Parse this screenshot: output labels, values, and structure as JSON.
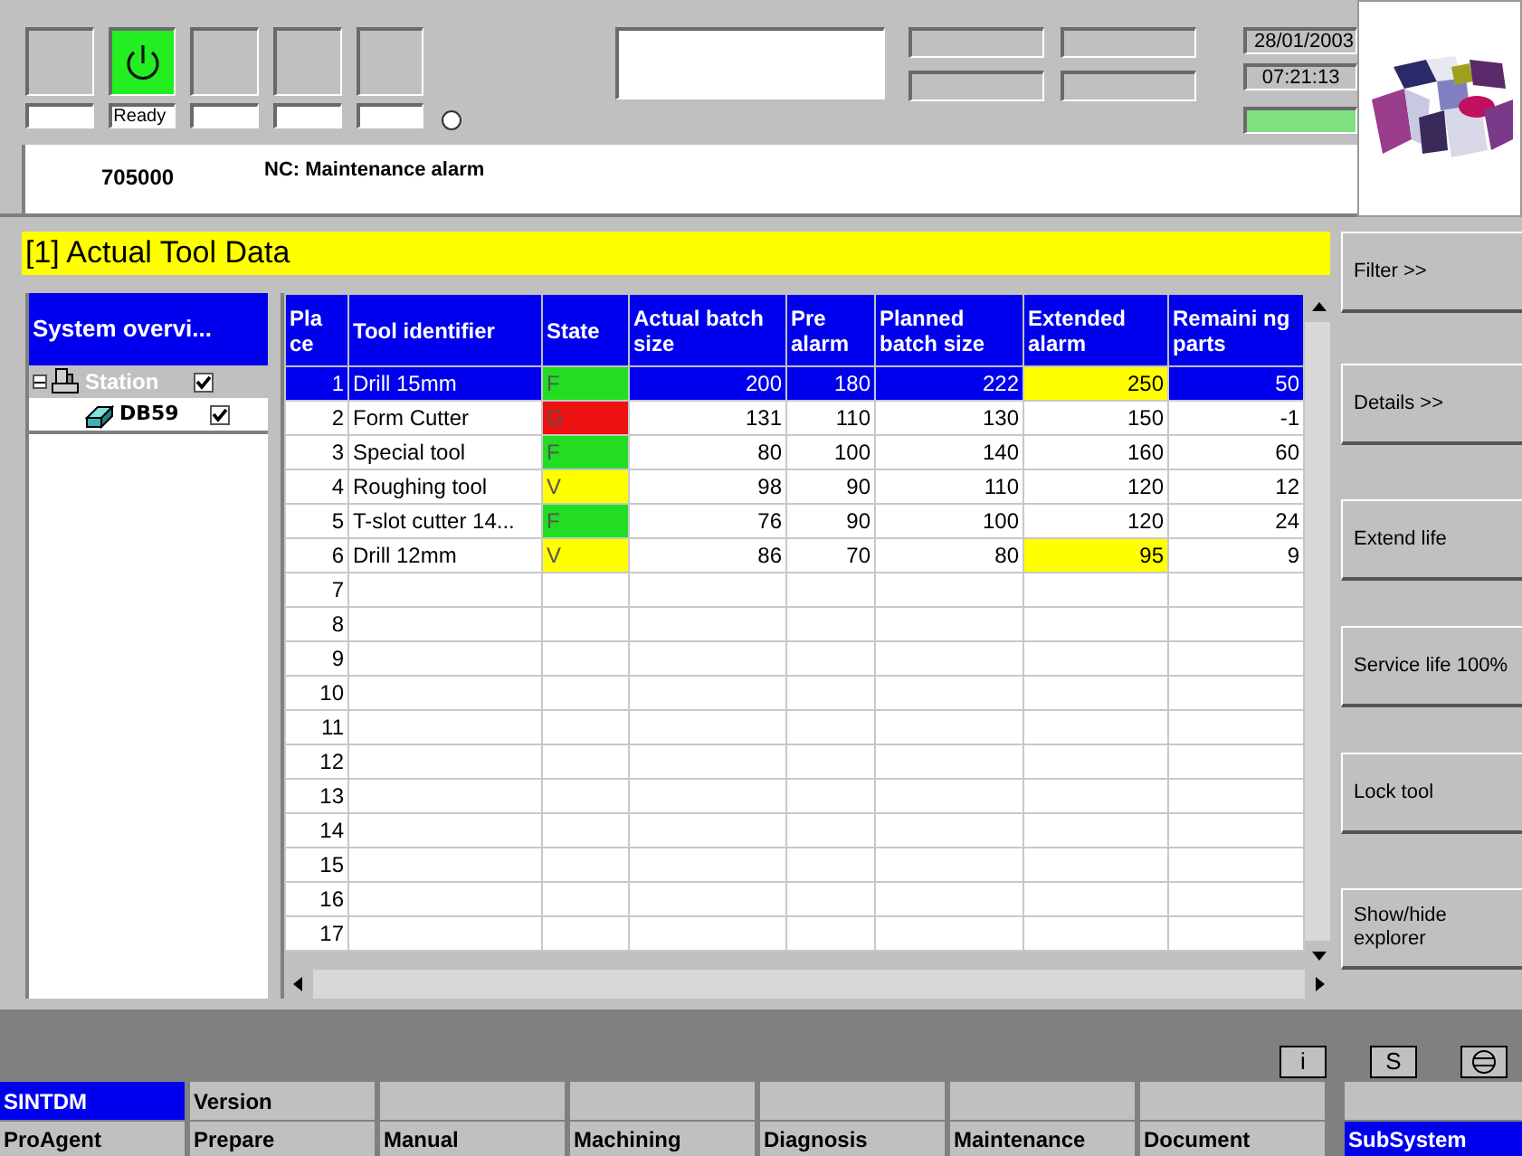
{
  "status_slots": [
    {
      "active": false
    },
    {
      "active": true,
      "label": "Ready"
    },
    {
      "active": false
    },
    {
      "active": false
    },
    {
      "active": false
    }
  ],
  "date": "28/01/2003",
  "time": "07:21:13",
  "alarm": {
    "number": "705000",
    "text": "NC: Maintenance alarm"
  },
  "title": "[1] Actual Tool Data",
  "explorer": {
    "title": "System overvi...",
    "items": [
      {
        "label": "Station",
        "selected": true,
        "checked": true,
        "children": [
          {
            "label": "DB59",
            "selected": false,
            "checked": true
          }
        ]
      }
    ]
  },
  "table": {
    "columns": [
      "Pla ce",
      "Tool identifier",
      "State",
      "Actual batch size",
      "Pre alarm",
      "Planned batch size",
      "Extended alarm",
      "Remaini ng parts"
    ],
    "rows": [
      {
        "place": "1",
        "tool": "Drill 15mm",
        "state": "F",
        "color": "#22dd22",
        "actual": "200",
        "pre": "180",
        "planned": "222",
        "extended": "250",
        "extended_warn": true,
        "remaining": "50",
        "selected": true
      },
      {
        "place": "2",
        "tool": "Form Cutter",
        "state": "G",
        "color": "#ee1111",
        "actual": "131",
        "pre": "110",
        "planned": "130",
        "extended": "150",
        "extended_warn": false,
        "remaining": "-1",
        "selected": false
      },
      {
        "place": "3",
        "tool": "Special tool",
        "state": "F",
        "color": "#22dd22",
        "actual": "80",
        "pre": "100",
        "planned": "140",
        "extended": "160",
        "extended_warn": false,
        "remaining": "60",
        "selected": false
      },
      {
        "place": "4",
        "tool": "Roughing tool",
        "state": "V",
        "color": "#ffff00",
        "actual": "98",
        "pre": "90",
        "planned": "110",
        "extended": "120",
        "extended_warn": false,
        "remaining": "12",
        "selected": false
      },
      {
        "place": "5",
        "tool": "T-slot cutter 14...",
        "state": "F",
        "color": "#22dd22",
        "actual": "76",
        "pre": "90",
        "planned": "100",
        "extended": "120",
        "extended_warn": false,
        "remaining": "24",
        "selected": false
      },
      {
        "place": "6",
        "tool": "Drill 12mm",
        "state": "V",
        "color": "#ffff00",
        "actual": "86",
        "pre": "70",
        "planned": "80",
        "extended": "95",
        "extended_warn": true,
        "remaining": "9",
        "selected": false
      },
      {
        "place": "7"
      },
      {
        "place": "8"
      },
      {
        "place": "9"
      },
      {
        "place": "10"
      },
      {
        "place": "11"
      },
      {
        "place": "12"
      },
      {
        "place": "13"
      },
      {
        "place": "14"
      },
      {
        "place": "15"
      },
      {
        "place": "16"
      },
      {
        "place": "17"
      }
    ]
  },
  "side_softkeys": [
    "Filter >>",
    "Details >>",
    "Extend life",
    "Service life 100%",
    "Lock tool",
    "Show/hide explorer"
  ],
  "icon_keys": [
    "i",
    "S"
  ],
  "upper_softkeys": [
    {
      "label": "SINTDM",
      "selected": true
    },
    {
      "label": "Version",
      "selected": false
    }
  ],
  "lower_softkeys": [
    {
      "label": "ProAgent",
      "selected": false
    },
    {
      "label": "Prepare",
      "selected": false
    },
    {
      "label": "Manual",
      "selected": false
    },
    {
      "label": "Machining",
      "selected": false
    },
    {
      "label": "Diagnosis",
      "selected": false
    },
    {
      "label": "Maintenance",
      "selected": false
    },
    {
      "label": "Document",
      "selected": false
    },
    {
      "label": "SubSystem",
      "selected": true
    }
  ]
}
